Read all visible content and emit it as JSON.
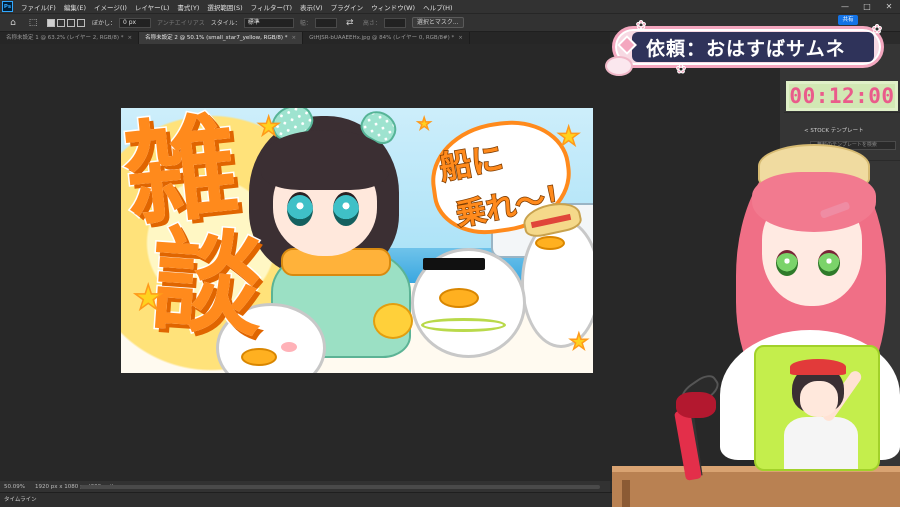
{
  "app": {
    "logo": "Ps",
    "menu": [
      "ファイル(F)",
      "編集(E)",
      "イメージ(I)",
      "レイヤー(L)",
      "書式(Y)",
      "選択範囲(S)",
      "フィルター(T)",
      "表示(V)",
      "プラグイン",
      "ウィンドウ(W)",
      "ヘルプ(H)"
    ],
    "window_controls": [
      "—",
      "□",
      "✕"
    ],
    "share_label": "共有"
  },
  "options": {
    "feather_label": "ぼかし：",
    "feather_value": "0 px",
    "antialias_label": "アンチエイリアス",
    "style_label": "スタイル：",
    "style_value": "標準",
    "width_label": "幅：",
    "height_label": "高さ：",
    "select_mask_label": "選択とマスク..."
  },
  "tabs": [
    {
      "label": "名称未設定 1 @ 63.2% (レイヤー 2, RGB/8) *",
      "active": false
    },
    {
      "label": "名称未設定 2 @ 50.1% (small_star7_yellow, RGB/8) *",
      "active": true
    },
    {
      "label": "GtHJSR-bUAAEEHx.jpg @ 84% (レイヤー 0, RGB/8#) *",
      "active": false
    }
  ],
  "tab_close": "×",
  "status": {
    "zoom": "50.09%",
    "doc_size": "1920 px x 1080 px (300 ppi)"
  },
  "timeline_label": "タイムライン",
  "right_panel": {
    "stock_label": "< STOCK テンプレート",
    "search_placeholder": "無料のテンプレートを検索"
  },
  "canvas": {
    "zatsu_1": "雑",
    "zatsu_2": "談",
    "funa_1": "船に",
    "funa_2": "乗れ〜！",
    "star_glyph": "★"
  },
  "overlay": {
    "title": "依頼：おはすばサムネ",
    "timer": "00:12:00",
    "sakura_glyph": "✿"
  },
  "colors": {
    "ps_bg": "#282828",
    "zatsu_orange": "#ff8a1c",
    "banner_navy": "#2f335a",
    "banner_pink": "#f4a7bf",
    "timer_green": "#d2e8b4",
    "timer_text": "#ea5b8b",
    "card_green": "#c4ee4c"
  }
}
